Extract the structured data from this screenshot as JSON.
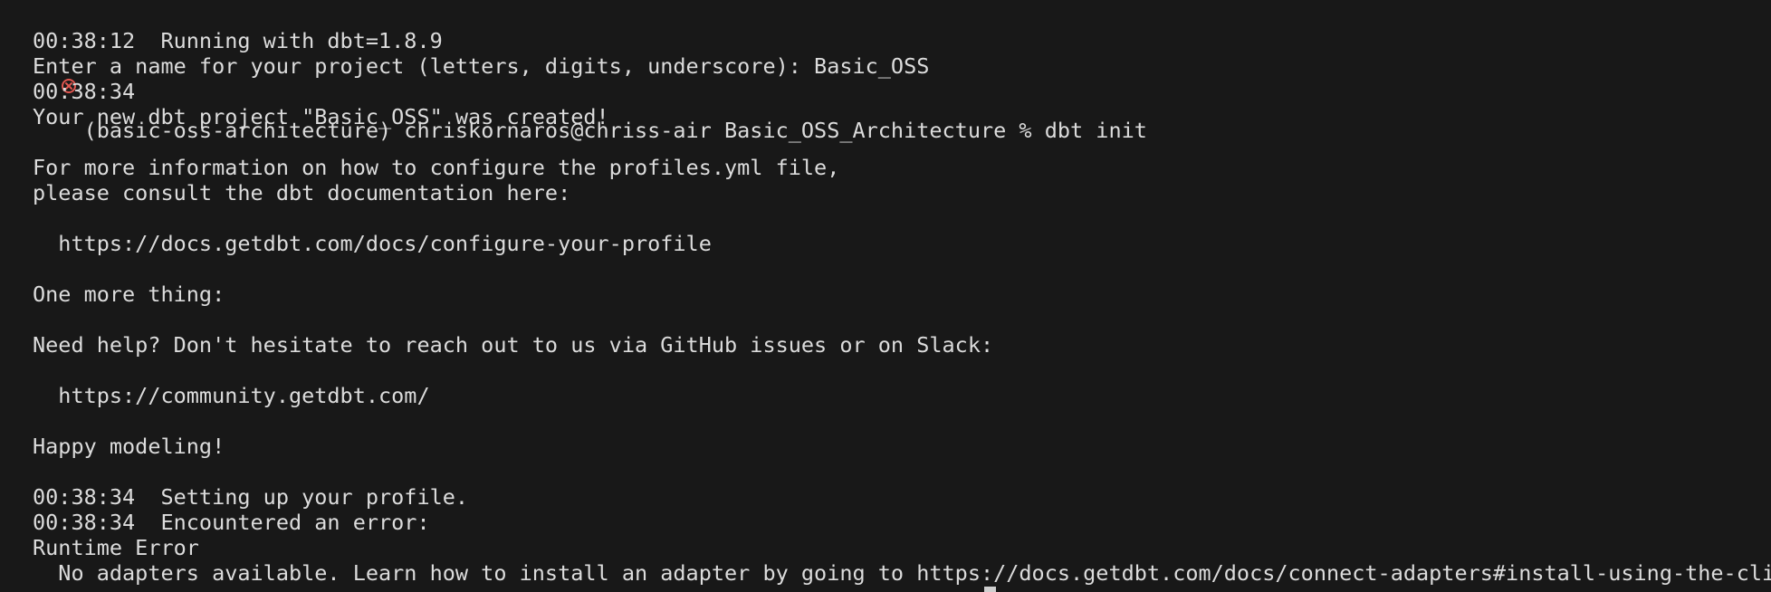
{
  "terminal": {
    "icon": "error-circle-icon",
    "colors": {
      "background": "#181818",
      "foreground": "#dcdcdc",
      "error_icon": "#e0564f"
    },
    "prompt": "(basic-oss-architecture) chriskornaros@chriss-air Basic_OSS_Architecture % dbt init",
    "lines": [
      "00:38:12  Running with dbt=1.8.9",
      "Enter a name for your project (letters, digits, underscore): Basic_OSS",
      "00:38:34",
      "Your new dbt project \"Basic_OSS\" was created!",
      "",
      "For more information on how to configure the profiles.yml file,",
      "please consult the dbt documentation here:",
      "",
      "  https://docs.getdbt.com/docs/configure-your-profile",
      "",
      "One more thing:",
      "",
      "Need help? Don't hesitate to reach out to us via GitHub issues or on Slack:",
      "",
      "  https://community.getdbt.com/",
      "",
      "Happy modeling!",
      "",
      "00:38:34  Setting up your profile.",
      "00:38:34  Encountered an error:",
      "Runtime Error",
      "  No adapters available. Learn how to install an adapter by going to https://docs.getdbt.com/docs/connect-adapters#install-using-the-cli"
    ]
  }
}
